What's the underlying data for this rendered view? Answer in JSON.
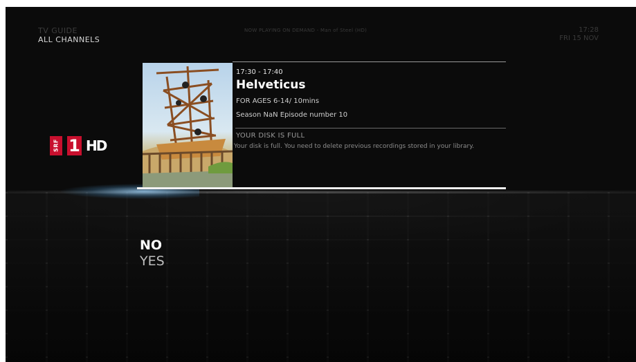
{
  "header": {
    "section": "TV GUIDE",
    "filter": "ALL CHANNELS",
    "now_playing": "NOW PLAYING ON DEMAND - Man of Steel (HD)",
    "time": "17:28",
    "date": "FRI 15 NOV"
  },
  "channel": {
    "logo_srf": "SRF",
    "logo_number": "1",
    "logo_hd": "HD",
    "accent_color": "#c8102e"
  },
  "program": {
    "time_range": "17:30 - 17:40",
    "title": "Helveticus",
    "ages_duration": "FOR AGES 6-14/ 10mins",
    "season_episode": "Season NaN Episode number 10"
  },
  "message": {
    "title": "YOUR DISK IS FULL",
    "body": "Your disk is full. You need to delete previous recordings stored in your library."
  },
  "options": {
    "no": "NO",
    "yes": "YES",
    "selected": "NO"
  }
}
